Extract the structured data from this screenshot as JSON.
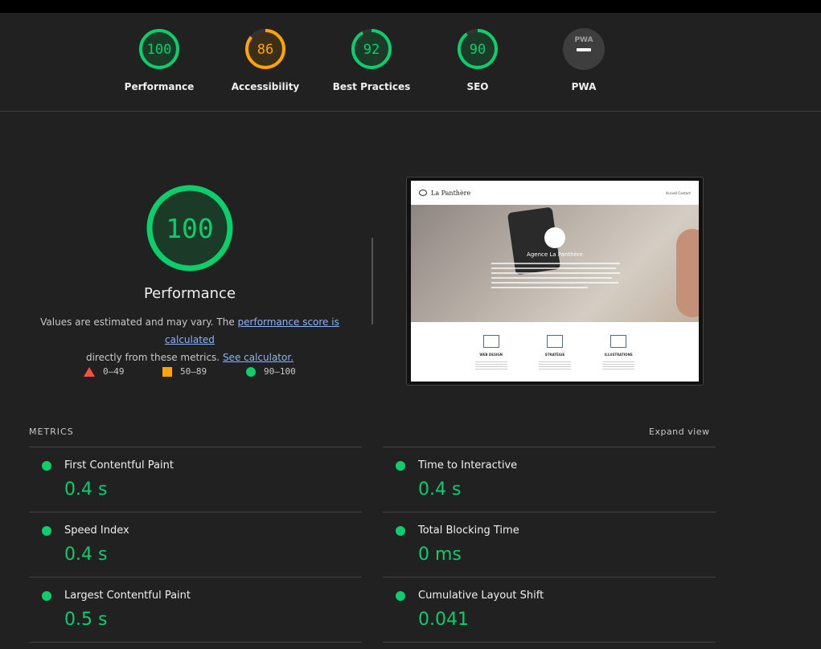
{
  "gauges": [
    {
      "score": "100",
      "label": "Performance",
      "color": "#0cce6b",
      "fill": "#1b3a27",
      "fraction": 1.0
    },
    {
      "score": "86",
      "label": "Accessibility",
      "color": "#ffa400",
      "fill": "#3b2f1a",
      "fraction": 0.86
    },
    {
      "score": "92",
      "label": "Best Practices",
      "color": "#0cce6b",
      "fill": "#1b3a27",
      "fraction": 0.92
    },
    {
      "score": "90",
      "label": "SEO",
      "color": "#0cce6b",
      "fill": "#1b3a27",
      "fraction": 0.9
    },
    {
      "score": "PWA",
      "label": "PWA",
      "color": "#9e9e9e",
      "fill": "#3e3e3e",
      "fraction": 0
    }
  ],
  "main": {
    "score": "100",
    "label": "Performance",
    "desc_before": "Values are estimated and may vary. The ",
    "desc_link1": "performance score is calculated",
    "desc_middle": "directly from these metrics. ",
    "desc_link2": "See calculator."
  },
  "legend": {
    "fail": "0–49",
    "average": "50–89",
    "pass": "90–100",
    "fail_color": "#ff4e42",
    "average_color": "#ffa400",
    "pass_color": "#0cce6b"
  },
  "screenshot": {
    "brand": "La Panthère",
    "nav_links": "Accueil    Contact",
    "hero_title": "Agence La Panthère",
    "services": [
      "WEB DESIGN",
      "STRATÉGIE",
      "ILLUSTRATIONS"
    ]
  },
  "metrics": {
    "title": "METRICS",
    "expand_label": "Expand view",
    "left": [
      {
        "name": "First Contentful Paint",
        "value": "0.4 s"
      },
      {
        "name": "Speed Index",
        "value": "0.4 s"
      },
      {
        "name": "Largest Contentful Paint",
        "value": "0.5 s"
      }
    ],
    "right": [
      {
        "name": "Time to Interactive",
        "value": "0.4 s"
      },
      {
        "name": "Total Blocking Time",
        "value": "0 ms"
      },
      {
        "name": "Cumulative Layout Shift",
        "value": "0.041"
      }
    ]
  }
}
